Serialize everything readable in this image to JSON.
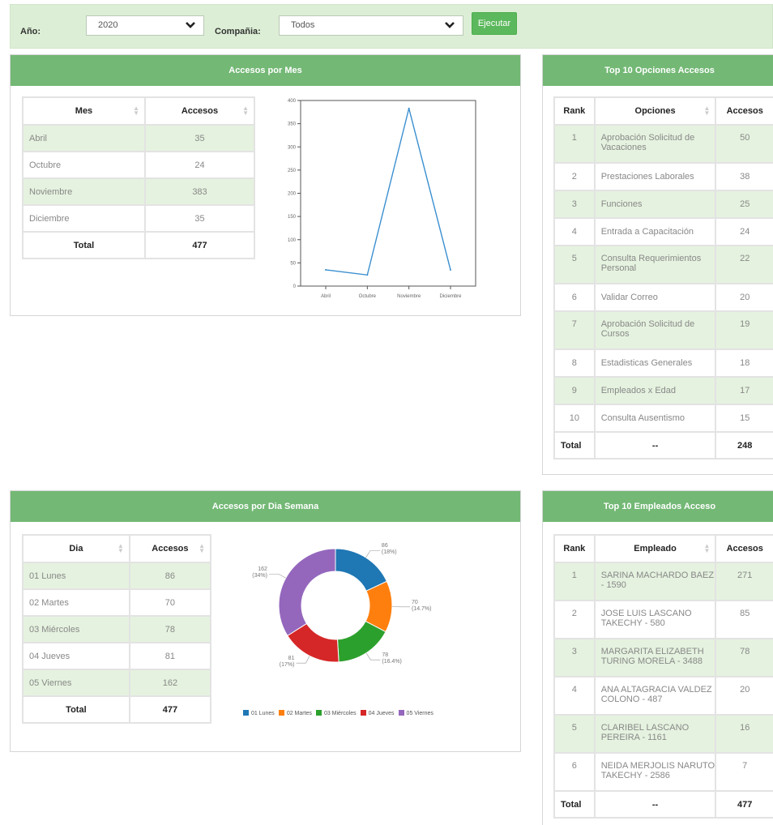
{
  "filters": {
    "year_label": "Año:",
    "year_value": "2020",
    "company_label": "Compañia:",
    "company_value": "Todos",
    "run_button": "Ejecutar"
  },
  "monthly": {
    "title": "Accesos por Mes",
    "headers": [
      "Mes",
      "Accesos"
    ],
    "rows": [
      {
        "month": "Abril",
        "count": "35"
      },
      {
        "month": "Octubre",
        "count": "24"
      },
      {
        "month": "Noviembre",
        "count": "383"
      },
      {
        "month": "Diciembre",
        "count": "35"
      }
    ],
    "total_label": "Total",
    "total_value": "477"
  },
  "top_options": {
    "title": "Top 10 Opciones Accesos",
    "headers": [
      "Rank",
      "Opciones",
      "Accesos"
    ],
    "rows": [
      {
        "rank": "1",
        "option": "Aprobación Solicitud de Vacaciones",
        "count": "50"
      },
      {
        "rank": "2",
        "option": "Prestaciones Laborales",
        "count": "38"
      },
      {
        "rank": "3",
        "option": "Funciones",
        "count": "25"
      },
      {
        "rank": "4",
        "option": "Entrada a Capacitación",
        "count": "24"
      },
      {
        "rank": "5",
        "option": "Consulta Requerimientos Personal",
        "count": "22"
      },
      {
        "rank": "6",
        "option": "Validar Correo",
        "count": "20"
      },
      {
        "rank": "7",
        "option": "Aprobación Solicitud de Cursos",
        "count": "19"
      },
      {
        "rank": "8",
        "option": "Estadisticas Generales",
        "count": "18"
      },
      {
        "rank": "9",
        "option": "Empleados x Edad",
        "count": "17"
      },
      {
        "rank": "10",
        "option": "Consulta Ausentismo",
        "count": "15"
      }
    ],
    "total_label": "Total",
    "total_mid": "--",
    "total_value": "248"
  },
  "weekday": {
    "title": "Accesos por Dia Semana",
    "headers": [
      "Dia",
      "Accesos"
    ],
    "rows": [
      {
        "day": "01 Lunes",
        "count": "86"
      },
      {
        "day": "02 Martes",
        "count": "70"
      },
      {
        "day": "03 Miércoles",
        "count": "78"
      },
      {
        "day": "04 Jueves",
        "count": "81"
      },
      {
        "day": "05 Viernes",
        "count": "162"
      }
    ],
    "total_label": "Total",
    "total_value": "477"
  },
  "top_employees": {
    "title": "Top 10 Empleados Acceso",
    "headers": [
      "Rank",
      "Empleado",
      "Accesos"
    ],
    "rows": [
      {
        "rank": "1",
        "employee": "SARINA MACHARDO BAEZ - 1590",
        "count": "271"
      },
      {
        "rank": "2",
        "employee": "JOSE LUIS LASCANO TAKECHY - 580",
        "count": "85"
      },
      {
        "rank": "3",
        "employee": "MARGARITA ELIZABETH TURING MORELA - 3488",
        "count": "78"
      },
      {
        "rank": "4",
        "employee": "ANA ALTAGRACIA VALDEZ COLONO - 487",
        "count": "20"
      },
      {
        "rank": "5",
        "employee": "CLARIBEL LASCANO PEREIRA - 1161",
        "count": "16"
      },
      {
        "rank": "6",
        "employee": "NEIDA MERJOLIS NARUTO TAKECHY - 2586",
        "count": "7"
      }
    ],
    "total_label": "Total",
    "total_mid": "--",
    "total_value": "477"
  },
  "colors": {
    "header_green": "#73b875",
    "row_green": "#e5f2df",
    "button_green": "#5cb85c",
    "line_blue": "#3a8fcf"
  },
  "chart_data": [
    {
      "type": "line",
      "categories": [
        "Abril",
        "Octubre",
        "Noviembre",
        "Diciembre"
      ],
      "values": [
        35,
        24,
        383,
        35
      ],
      "ylim": [
        0,
        400
      ],
      "yticks": [
        "0",
        "50",
        "100",
        "150",
        "200",
        "250",
        "300",
        "350",
        "400"
      ],
      "color": "#3a8fcf"
    },
    {
      "type": "pie",
      "donut": true,
      "labels": [
        "01 Lunes",
        "02 Martes",
        "03 Miércoles",
        "04 Jueves",
        "05 Viernes"
      ],
      "values": [
        86,
        70,
        78,
        81,
        162
      ],
      "value_labels": [
        "86",
        "70",
        "78",
        "81",
        "162"
      ],
      "pct_labels": [
        "(18%)",
        "(14.7%)",
        "(16.4%)",
        "(17%)",
        "(34%)"
      ],
      "colors": [
        "#1f77b4",
        "#ff7f0e",
        "#2ca02c",
        "#d62728",
        "#9467bd"
      ],
      "legend_position": "bottom"
    }
  ]
}
